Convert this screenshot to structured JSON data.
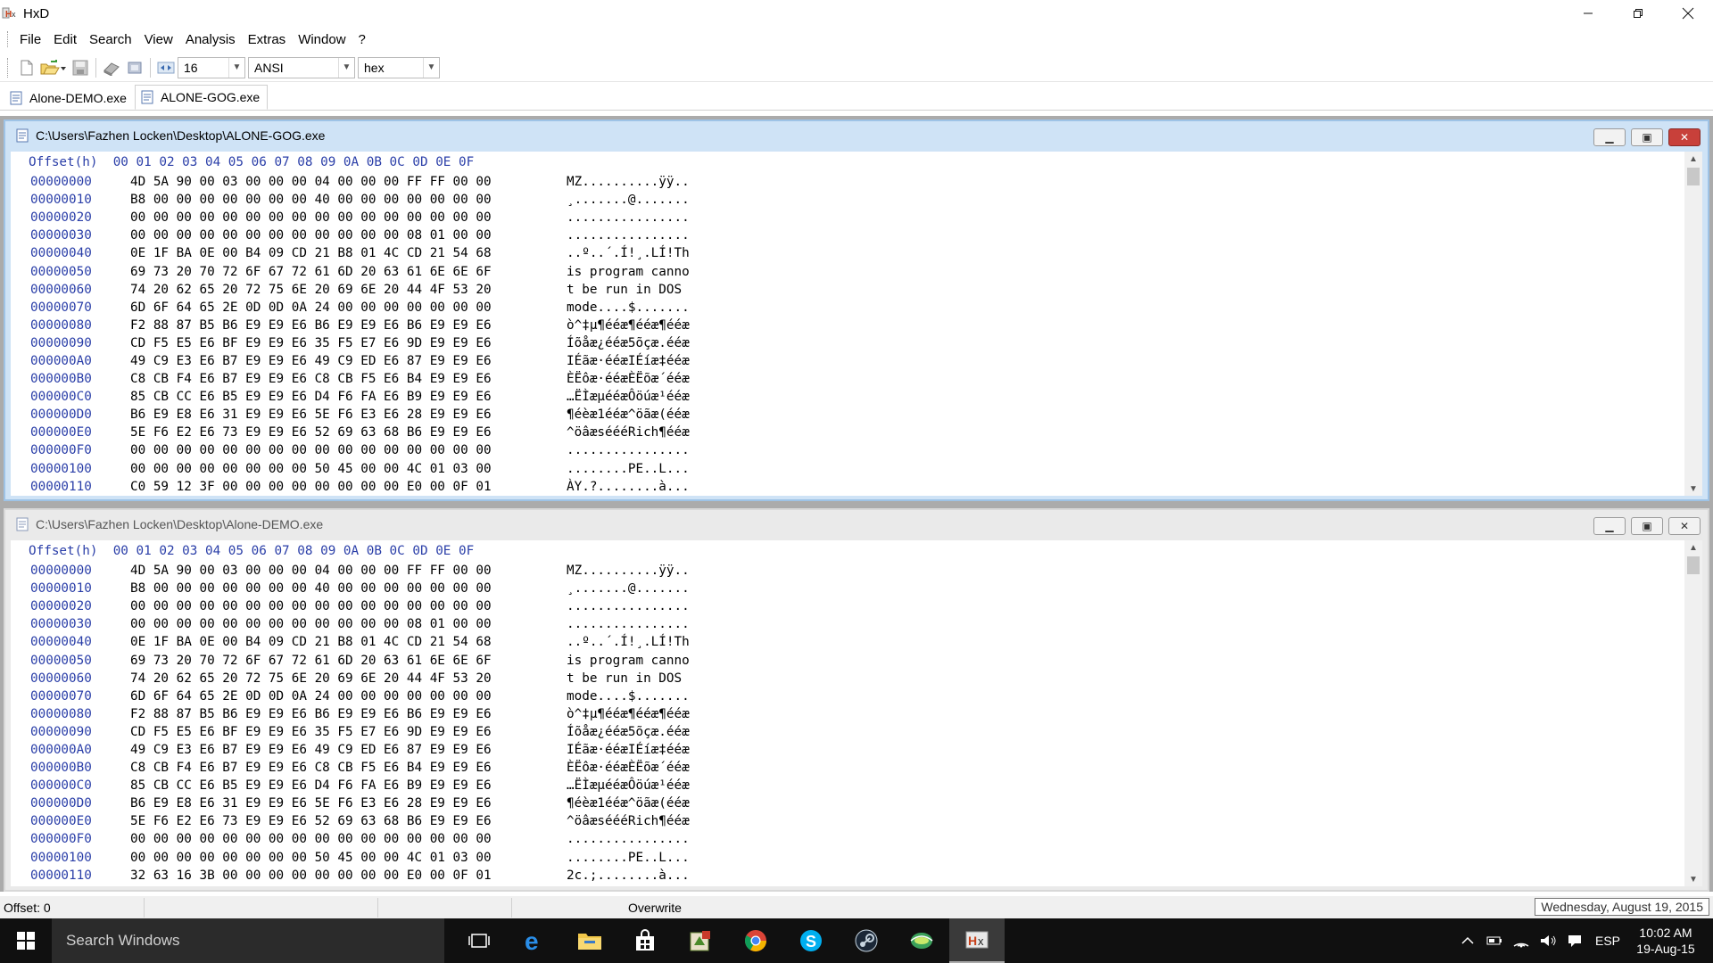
{
  "app": {
    "title": "HxD",
    "window_controls": [
      "minimize",
      "restore",
      "close"
    ]
  },
  "menu": [
    "File",
    "Edit",
    "Search",
    "View",
    "Analysis",
    "Extras",
    "Window",
    "?"
  ],
  "toolbar": {
    "bytes_per_row": "16",
    "charset": "ANSI",
    "offset_base": "hex"
  },
  "tabs": [
    {
      "label": "Alone-DEMO.exe",
      "active": false
    },
    {
      "label": "ALONE-GOG.exe",
      "active": true
    }
  ],
  "header": {
    "offset_label": "Offset(h)",
    "columns": [
      "00",
      "01",
      "02",
      "03",
      "04",
      "05",
      "06",
      "07",
      "08",
      "09",
      "0A",
      "0B",
      "0C",
      "0D",
      "0E",
      "0F"
    ]
  },
  "windows": [
    {
      "path": "C:\\Users\\Fazhen Locken\\Desktop\\ALONE-GOG.exe",
      "active": true,
      "rows": [
        {
          "offset": "00000000",
          "bytes": "4D 5A 90 00 03 00 00 00 04 00 00 00 FF FF 00 00",
          "ascii": "MZ..........ÿÿ.."
        },
        {
          "offset": "00000010",
          "bytes": "B8 00 00 00 00 00 00 00 40 00 00 00 00 00 00 00",
          "ascii": "¸.......@......."
        },
        {
          "offset": "00000020",
          "bytes": "00 00 00 00 00 00 00 00 00 00 00 00 00 00 00 00",
          "ascii": "................"
        },
        {
          "offset": "00000030",
          "bytes": "00 00 00 00 00 00 00 00 00 00 00 00 08 01 00 00",
          "ascii": "................"
        },
        {
          "offset": "00000040",
          "bytes": "0E 1F BA 0E 00 B4 09 CD 21 B8 01 4C CD 21 54 68",
          "ascii": "..º..´.Í!¸.LÍ!Th"
        },
        {
          "offset": "00000050",
          "bytes": "69 73 20 70 72 6F 67 72 61 6D 20 63 61 6E 6E 6F",
          "ascii": "is program canno"
        },
        {
          "offset": "00000060",
          "bytes": "74 20 62 65 20 72 75 6E 20 69 6E 20 44 4F 53 20",
          "ascii": "t be run in DOS "
        },
        {
          "offset": "00000070",
          "bytes": "6D 6F 64 65 2E 0D 0D 0A 24 00 00 00 00 00 00 00",
          "ascii": "mode....$......."
        },
        {
          "offset": "00000080",
          "bytes": "F2 88 87 B5 B6 E9 E9 E6 B6 E9 E9 E6 B6 E9 E9 E6",
          "ascii": "ò^‡µ¶ééæ¶ééæ¶ééæ"
        },
        {
          "offset": "00000090",
          "bytes": "CD F5 E5 E6 BF E9 E9 E6 35 F5 E7 E6 9D E9 E9 E6",
          "ascii": "Íõåæ¿ééæ5õçæ.ééæ"
        },
        {
          "offset": "000000A0",
          "bytes": "49 C9 E3 E6 B7 E9 E9 E6 49 C9 ED E6 87 E9 E9 E6",
          "ascii": "IÉãæ·ééæIÉíæ‡ééæ"
        },
        {
          "offset": "000000B0",
          "bytes": "C8 CB F4 E6 B7 E9 E9 E6 C8 CB F5 E6 B4 E9 E9 E6",
          "ascii": "ÈËôæ·ééæÈËõæ´ééæ"
        },
        {
          "offset": "000000C0",
          "bytes": "85 CB CC E6 B5 E9 E9 E6 D4 F6 FA E6 B9 E9 E9 E6",
          "ascii": "…ËÌæµééæÔöúæ¹ééæ"
        },
        {
          "offset": "000000D0",
          "bytes": "B6 E9 E8 E6 31 E9 E9 E6 5E F6 E3 E6 28 E9 E9 E6",
          "ascii": "¶éèæ1ééæ^öãæ(ééæ"
        },
        {
          "offset": "000000E0",
          "bytes": "5E F6 E2 E6 73 E9 E9 E6 52 69 63 68 B6 E9 E9 E6",
          "ascii": "^öâæséééRich¶ééæ"
        },
        {
          "offset": "000000F0",
          "bytes": "00 00 00 00 00 00 00 00 00 00 00 00 00 00 00 00",
          "ascii": "................"
        },
        {
          "offset": "00000100",
          "bytes": "00 00 00 00 00 00 00 00 50 45 00 00 4C 01 03 00",
          "ascii": "........PE..L..."
        },
        {
          "offset": "00000110",
          "bytes": "C0 59 12 3F 00 00 00 00 00 00 00 00 E0 00 0F 01",
          "ascii": "ÀY.?........à..."
        }
      ]
    },
    {
      "path": "C:\\Users\\Fazhen Locken\\Desktop\\Alone-DEMO.exe",
      "active": false,
      "rows": [
        {
          "offset": "00000000",
          "bytes": "4D 5A 90 00 03 00 00 00 04 00 00 00 FF FF 00 00",
          "ascii": "MZ..........ÿÿ.."
        },
        {
          "offset": "00000010",
          "bytes": "B8 00 00 00 00 00 00 00 40 00 00 00 00 00 00 00",
          "ascii": "¸.......@......."
        },
        {
          "offset": "00000020",
          "bytes": "00 00 00 00 00 00 00 00 00 00 00 00 00 00 00 00",
          "ascii": "................"
        },
        {
          "offset": "00000030",
          "bytes": "00 00 00 00 00 00 00 00 00 00 00 00 08 01 00 00",
          "ascii": "................"
        },
        {
          "offset": "00000040",
          "bytes": "0E 1F BA 0E 00 B4 09 CD 21 B8 01 4C CD 21 54 68",
          "ascii": "..º..´.Í!¸.LÍ!Th"
        },
        {
          "offset": "00000050",
          "bytes": "69 73 20 70 72 6F 67 72 61 6D 20 63 61 6E 6E 6F",
          "ascii": "is program canno"
        },
        {
          "offset": "00000060",
          "bytes": "74 20 62 65 20 72 75 6E 20 69 6E 20 44 4F 53 20",
          "ascii": "t be run in DOS "
        },
        {
          "offset": "00000070",
          "bytes": "6D 6F 64 65 2E 0D 0D 0A 24 00 00 00 00 00 00 00",
          "ascii": "mode....$......."
        },
        {
          "offset": "00000080",
          "bytes": "F2 88 87 B5 B6 E9 E9 E6 B6 E9 E9 E6 B6 E9 E9 E6",
          "ascii": "ò^‡µ¶ééæ¶ééæ¶ééæ"
        },
        {
          "offset": "00000090",
          "bytes": "CD F5 E5 E6 BF E9 E9 E6 35 F5 E7 E6 9D E9 E9 E6",
          "ascii": "Íõåæ¿ééæ5õçæ.ééæ"
        },
        {
          "offset": "000000A0",
          "bytes": "49 C9 E3 E6 B7 E9 E9 E6 49 C9 ED E6 87 E9 E9 E6",
          "ascii": "IÉãæ·ééæIÉíæ‡ééæ"
        },
        {
          "offset": "000000B0",
          "bytes": "C8 CB F4 E6 B7 E9 E9 E6 C8 CB F5 E6 B4 E9 E9 E6",
          "ascii": "ÈËôæ·ééæÈËõæ´ééæ"
        },
        {
          "offset": "000000C0",
          "bytes": "85 CB CC E6 B5 E9 E9 E6 D4 F6 FA E6 B9 E9 E9 E6",
          "ascii": "…ËÌæµééæÔöúæ¹ééæ"
        },
        {
          "offset": "000000D0",
          "bytes": "B6 E9 E8 E6 31 E9 E9 E6 5E F6 E3 E6 28 E9 E9 E6",
          "ascii": "¶éèæ1ééæ^öãæ(ééæ"
        },
        {
          "offset": "000000E0",
          "bytes": "5E F6 E2 E6 73 E9 E9 E6 52 69 63 68 B6 E9 E9 E6",
          "ascii": "^öâæséééRich¶ééæ"
        },
        {
          "offset": "000000F0",
          "bytes": "00 00 00 00 00 00 00 00 00 00 00 00 00 00 00 00",
          "ascii": "................"
        },
        {
          "offset": "00000100",
          "bytes": "00 00 00 00 00 00 00 00 50 45 00 00 4C 01 03 00",
          "ascii": "........PE..L..."
        },
        {
          "offset": "00000110",
          "bytes": "32 63 16 3B 00 00 00 00 00 00 00 00 E0 00 0F 01",
          "ascii": "2c.;........à..."
        }
      ]
    }
  ],
  "status": {
    "offset": "Offset: 0",
    "mode": "Overwrite",
    "tooltip": "Wednesday, August 19, 2015"
  },
  "taskbar": {
    "search_placeholder": "Search Windows",
    "language": "ESP",
    "time": "10:02 AM",
    "date": "19-Aug-15"
  },
  "colors": {
    "offset_blue": "#2a3ea8",
    "active_frame": "#cfe3f6",
    "close_red": "#c8403a"
  }
}
